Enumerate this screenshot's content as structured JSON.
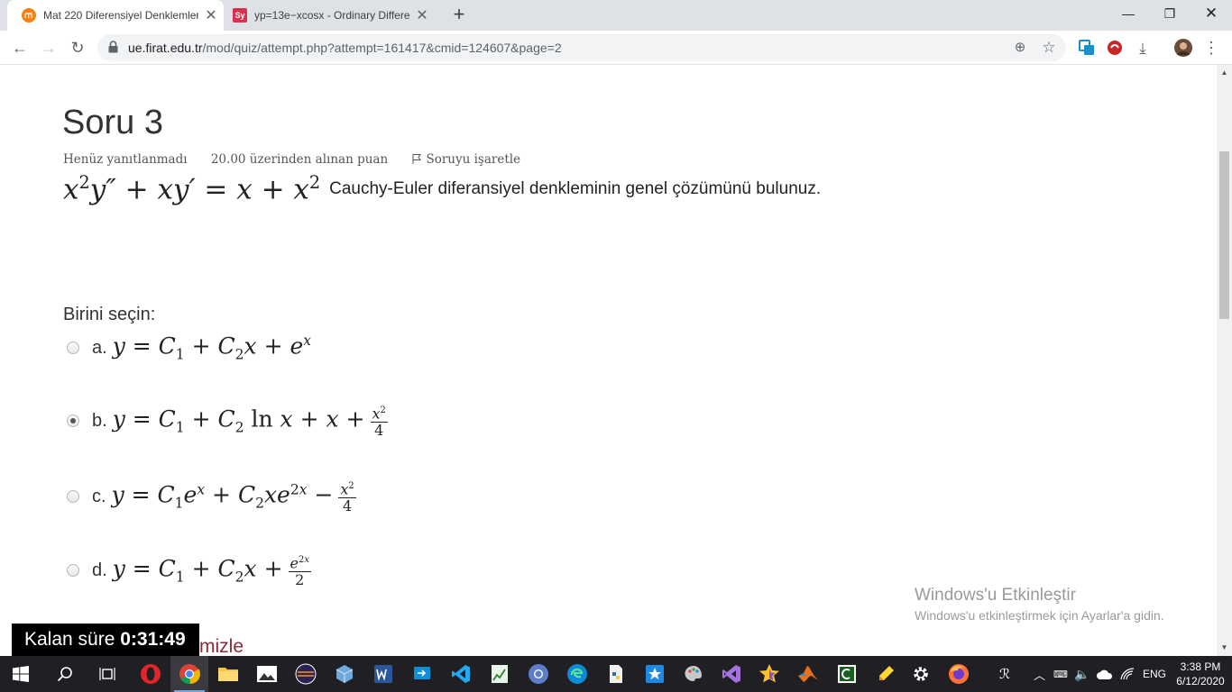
{
  "browser": {
    "tabs": [
      {
        "title": "Mat 220 Diferensiyel Denklemler",
        "active": true,
        "favicon": "moodle-icon"
      },
      {
        "title": "yp=13e−xcosx - Ordinary Differe",
        "active": false,
        "favicon": "symbolab-icon",
        "favicon_text": "Sy"
      }
    ],
    "url": {
      "host": "ue.firat.edu.tr",
      "path": "/mod/quiz/attempt.php?attempt=161417&cmid=124607&page=2"
    }
  },
  "quiz": {
    "title": "Soru 3",
    "status": "Henüz yanıtlanmadı",
    "points": "20.00 üzerinden alınan puan",
    "flag_label": "Soruyu işaretle",
    "question_text": "Cauchy-Euler diferansiyel denkleminin genel çözümünü bulunuz.",
    "prompt": "Birini seçin:",
    "options": [
      {
        "letter": "a.",
        "selected": false
      },
      {
        "letter": "b.",
        "selected": true
      },
      {
        "letter": "c.",
        "selected": false
      },
      {
        "letter": "d.",
        "selected": false
      }
    ]
  },
  "timer": {
    "label": "Kalan süre",
    "value": "0:31:49"
  },
  "partial_link": "mizle",
  "watermark": {
    "title": "Windows'u Etkinleştir",
    "subtitle": "Windows'u etkinleştirmek için Ayarlar'a gidin."
  },
  "taskbar": {
    "language": "ENG",
    "time": "3:38 PM",
    "date": "6/12/2020",
    "colors": {
      "background": "#1f1f24",
      "accent": "#7aa6dc"
    }
  }
}
